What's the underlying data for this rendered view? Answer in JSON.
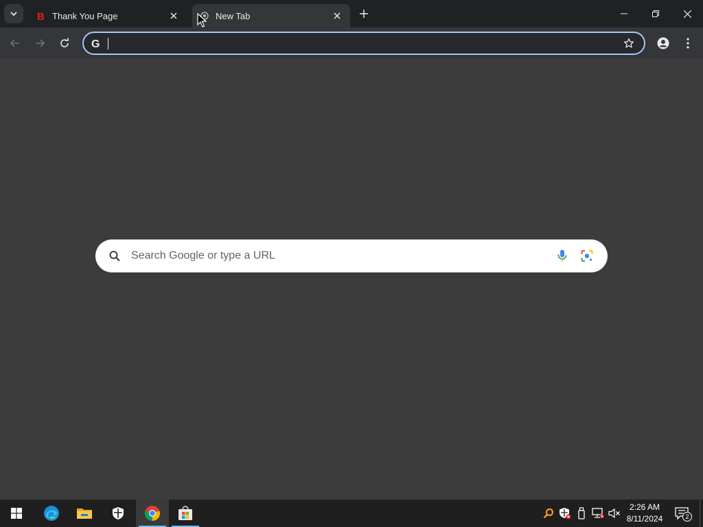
{
  "browser": {
    "tabs": [
      {
        "title": "Thank You Page",
        "favicon": "brave-b-icon",
        "active": false
      },
      {
        "title": "New Tab",
        "favicon": "chrome-newtab-icon",
        "active": true
      }
    ],
    "omnibox": {
      "value": "",
      "search_engine_icon": "google-g-icon"
    }
  },
  "new_tab_page": {
    "search_placeholder": "Search Google or type a URL"
  },
  "taskbar": {
    "pinned_apps": [
      "windows-start-icon",
      "edge-icon",
      "file-explorer-icon",
      "windows-security-icon",
      "chrome-icon",
      "microsoft-store-icon"
    ],
    "tray_icons": [
      "search-tray-icon",
      "defender-alert-icon",
      "usb-device-icon",
      "network-disconnected-icon",
      "volume-muted-icon"
    ],
    "clock": {
      "time": "2:26 AM",
      "date": "8/11/2024"
    },
    "notification_count": "2"
  },
  "colors": {
    "titlebar": "#202124",
    "toolbar": "#35363a",
    "content_bg": "#3c3c3c",
    "omnibox_focus_ring": "#a8c7fa",
    "taskbar": "#1f1f1f"
  }
}
